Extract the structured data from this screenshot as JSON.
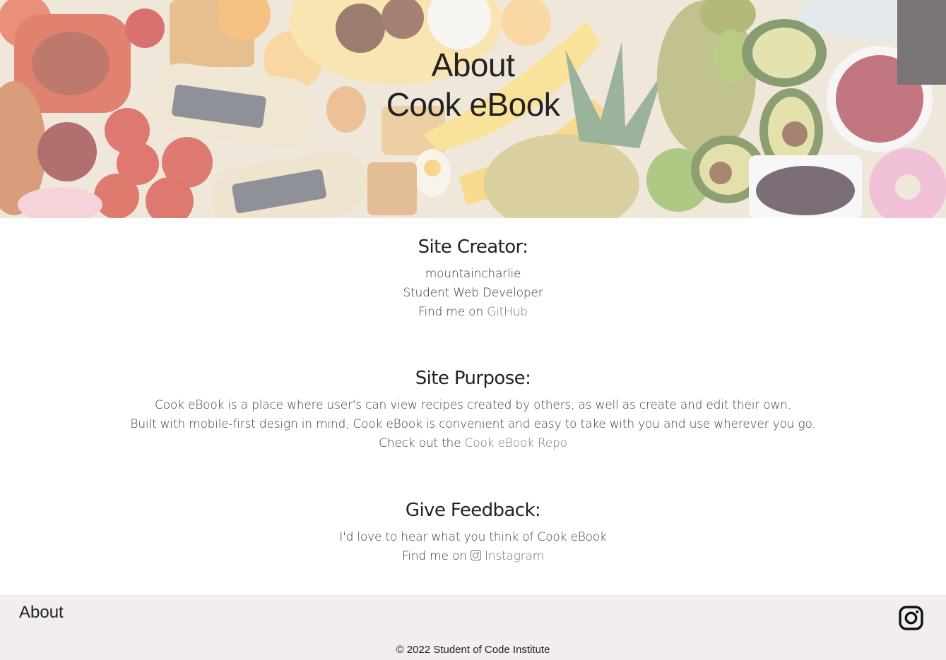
{
  "hero": {
    "title_line1": "About",
    "title_line2": "Cook eBook"
  },
  "creator": {
    "heading": "Site Creator:",
    "name": "mountaincharlie",
    "role": "Student Web Developer",
    "find_prefix": "Find me on",
    "github_link": "GitHub"
  },
  "purpose": {
    "heading": "Site Purpose:",
    "line1": "Cook eBook is a place where user's can view recipes created by others, as well as create and edit their own.",
    "line2": "Built with mobile-first design in mind, Cook eBook is convenient and easy to take with you and use wherever you go.",
    "repo_prefix": "Check out the",
    "repo_link": "Cook eBook Repo"
  },
  "feedback": {
    "heading": "Give Feedback:",
    "line1": "I'd love to hear what you think of Cook eBook",
    "find_prefix": "Find me on",
    "instagram_link": "Instagram"
  },
  "footer": {
    "about_link": "About",
    "copyright": "© 2022 Student of Code Institute"
  },
  "colors": {
    "link": "#6d757d",
    "text": "#222222",
    "footer_bg": "#f2eeee"
  },
  "icons": {
    "inline_social": "instagram-icon",
    "footer_social": "instagram-icon"
  }
}
